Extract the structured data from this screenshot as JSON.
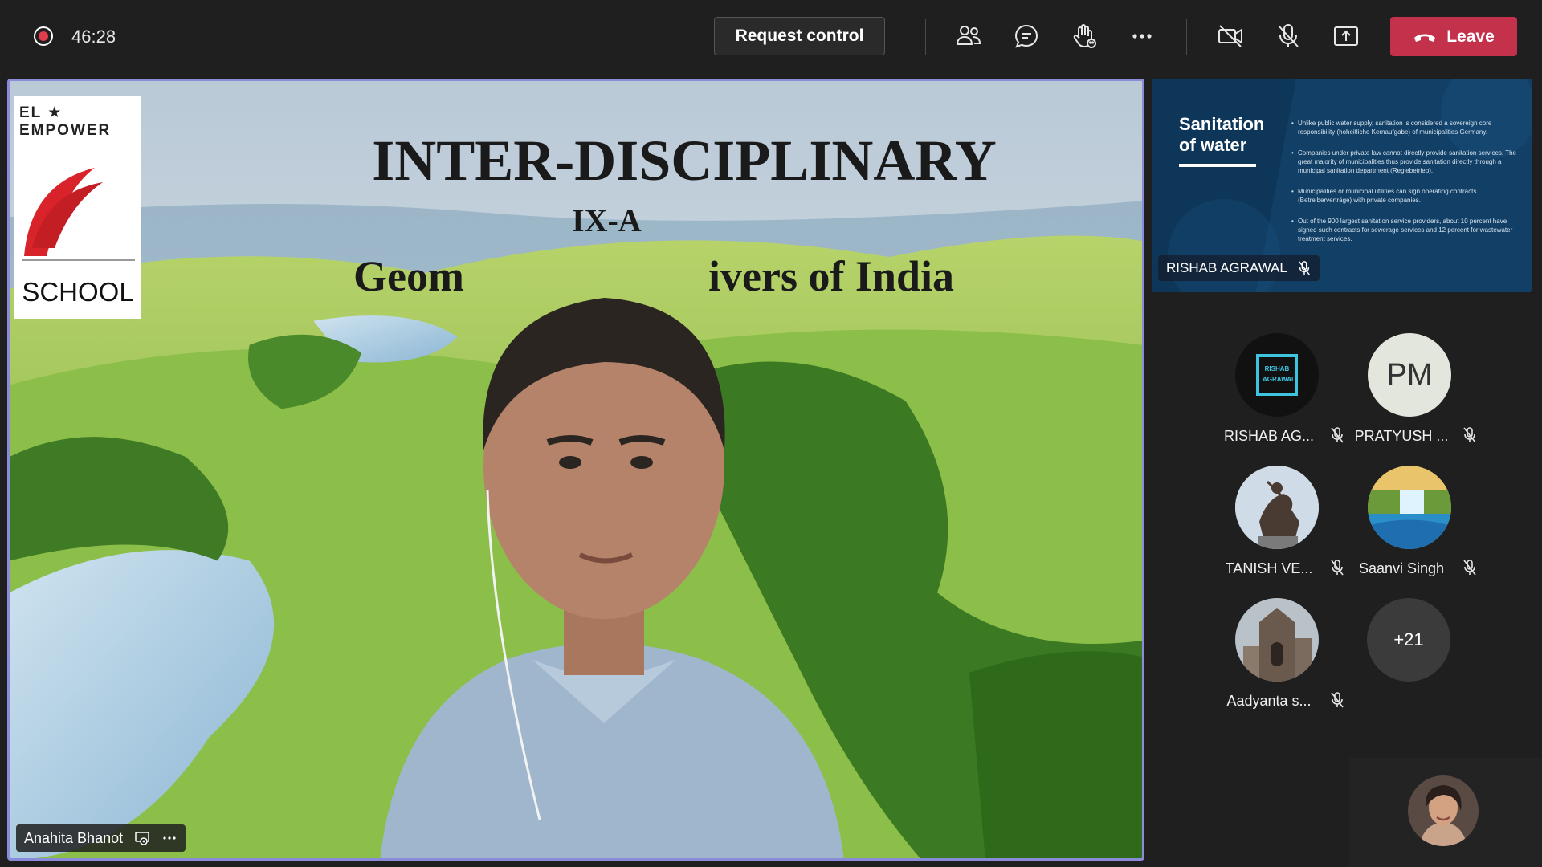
{
  "topbar": {
    "timer": "46:28",
    "request_control_label": "Request control",
    "leave_label": "Leave"
  },
  "stage": {
    "slide": {
      "logo_arc_text": "EL ★ EMPOWER",
      "logo_school": "SCHOOL",
      "title": "INTER-DISCIPLINARY",
      "subtitle": "IX-A",
      "line_left": "Geom",
      "line_right": "ivers of India"
    },
    "presenter_name": "Anahita Bhanot"
  },
  "shared_content": {
    "title": "Sanitation of water",
    "bullets": [
      "Unlike public water supply, sanitation is considered a sovereign core responsibility (hoheitliche Kernaufgabe) of municipalities Germany.",
      "Companies under private law cannot directly provide sanitation services. The great majority of municipalities thus provide sanitation directly through a municipal sanitation department (Regiebetrieb).",
      "Municipalities or municipal utilities can sign operating contracts (Betreiberverträge) with private companies.",
      "Out of the 900 largest sanitation service providers, about 10 percent have signed such contracts for sewerage services and 12 percent for wastewater treatment services."
    ],
    "owner_name": "RISHAB AGRAWAL"
  },
  "participants": [
    {
      "name": "RISHAB AG...",
      "avatar_text": "RISHAB AGRAWAL",
      "avatar_type": "logo"
    },
    {
      "name": "PRATYUSH ...",
      "avatar_text": "PM",
      "avatar_type": "initials"
    },
    {
      "name": "TANISH VE...",
      "avatar_type": "photo-statue"
    },
    {
      "name": "Saanvi Singh",
      "avatar_type": "photo-waterfall"
    },
    {
      "name": "Aadyanta s...",
      "avatar_type": "photo-temple"
    }
  ],
  "more_participants": "+21",
  "colors": {
    "accent_border": "#8b8cd9",
    "leave": "#c4314b",
    "record": "#e23d4b",
    "background": "#1f1f1f"
  }
}
